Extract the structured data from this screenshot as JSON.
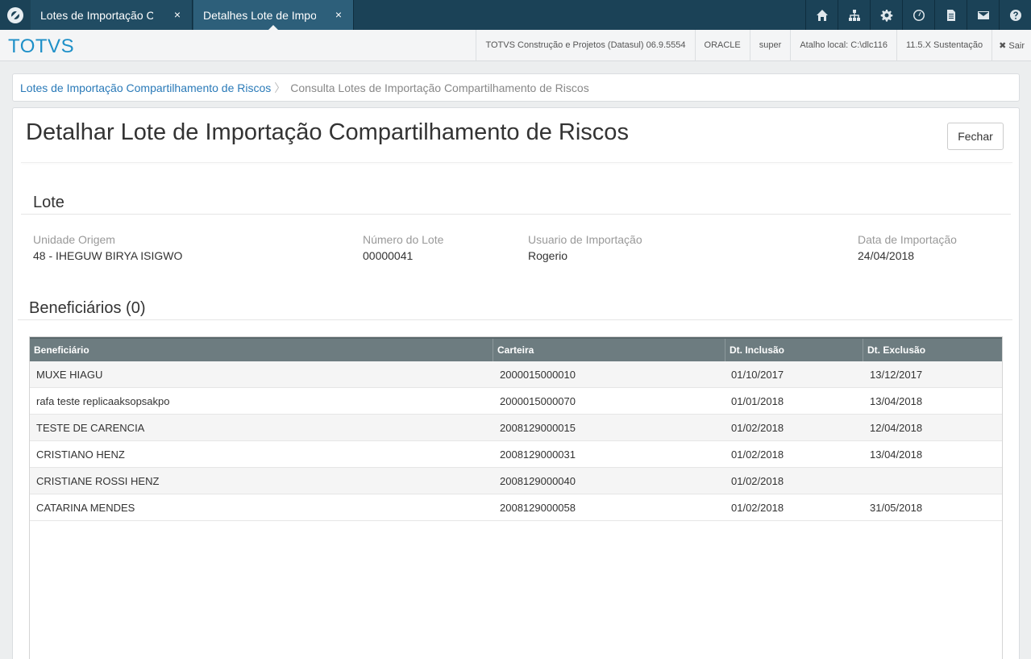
{
  "tabs": [
    {
      "label": "Lotes de Importação Compartilhamento de Riscos",
      "close": "×"
    },
    {
      "label": "Detalhes Lote de Importação",
      "close": "×"
    }
  ],
  "top_icons": [
    "home-icon",
    "sitemap-icon",
    "gear-icon",
    "clock-icon",
    "document-icon",
    "envelope-icon",
    "help-icon"
  ],
  "header": {
    "brand": "TOTVS",
    "product": "TOTVS Construção e Projetos (Datasul) 06.9.5554",
    "database": "ORACLE",
    "user": "super",
    "shortcut": "Atalho local: C:\\dlc116",
    "version": "11.5.X Sustentação",
    "exit": "✖ Sair"
  },
  "breadcrumb": {
    "parent": "Lotes de Importação Compartilhamento de Riscos",
    "separator": "〉",
    "current": "Consulta Lotes de Importação Compartilhamento de Riscos"
  },
  "page": {
    "title": "Detalhar Lote de Importação Compartilhamento de Riscos",
    "close_button": "Fechar"
  },
  "lote": {
    "section_title": "Lote",
    "unidade_label": "Unidade Origem",
    "unidade_value": "48 - IHEGUW BIRYA ISIGWO",
    "numero_label": "Número do Lote",
    "numero_value": "00000041",
    "usuario_label": "Usuario de Importação",
    "usuario_value": "Rogerio",
    "data_label": "Data de Importação",
    "data_value": "24/04/2018"
  },
  "beneficiarios": {
    "section_title": "Beneficiários (0)",
    "columns": [
      "Beneficiário",
      "Carteira",
      "Dt. Inclusão",
      "Dt. Exclusão"
    ],
    "rows": [
      [
        "MUXE HIAGU",
        "2000015000010",
        "01/10/2017",
        "13/12/2017"
      ],
      [
        "rafa teste replicaaksopsakpo",
        "2000015000070",
        "01/01/2018",
        "13/04/2018"
      ],
      [
        "TESTE DE CARENCIA",
        "2008129000015",
        "01/02/2018",
        "12/04/2018"
      ],
      [
        "CRISTIANO HENZ",
        "2008129000031",
        "01/02/2018",
        "13/04/2018"
      ],
      [
        "CRISTIANE ROSSI HENZ",
        "2008129000040",
        "01/02/2018",
        ""
      ],
      [
        "CATARINA MENDES",
        "2008129000058",
        "01/02/2018",
        "31/05/2018"
      ]
    ]
  },
  "colors": {
    "topbar": "#1b4257",
    "active_tab": "#2d5f7a",
    "brand": "#1e90c8",
    "link": "#2a7ab8",
    "grid_header": "#6d7c80"
  }
}
